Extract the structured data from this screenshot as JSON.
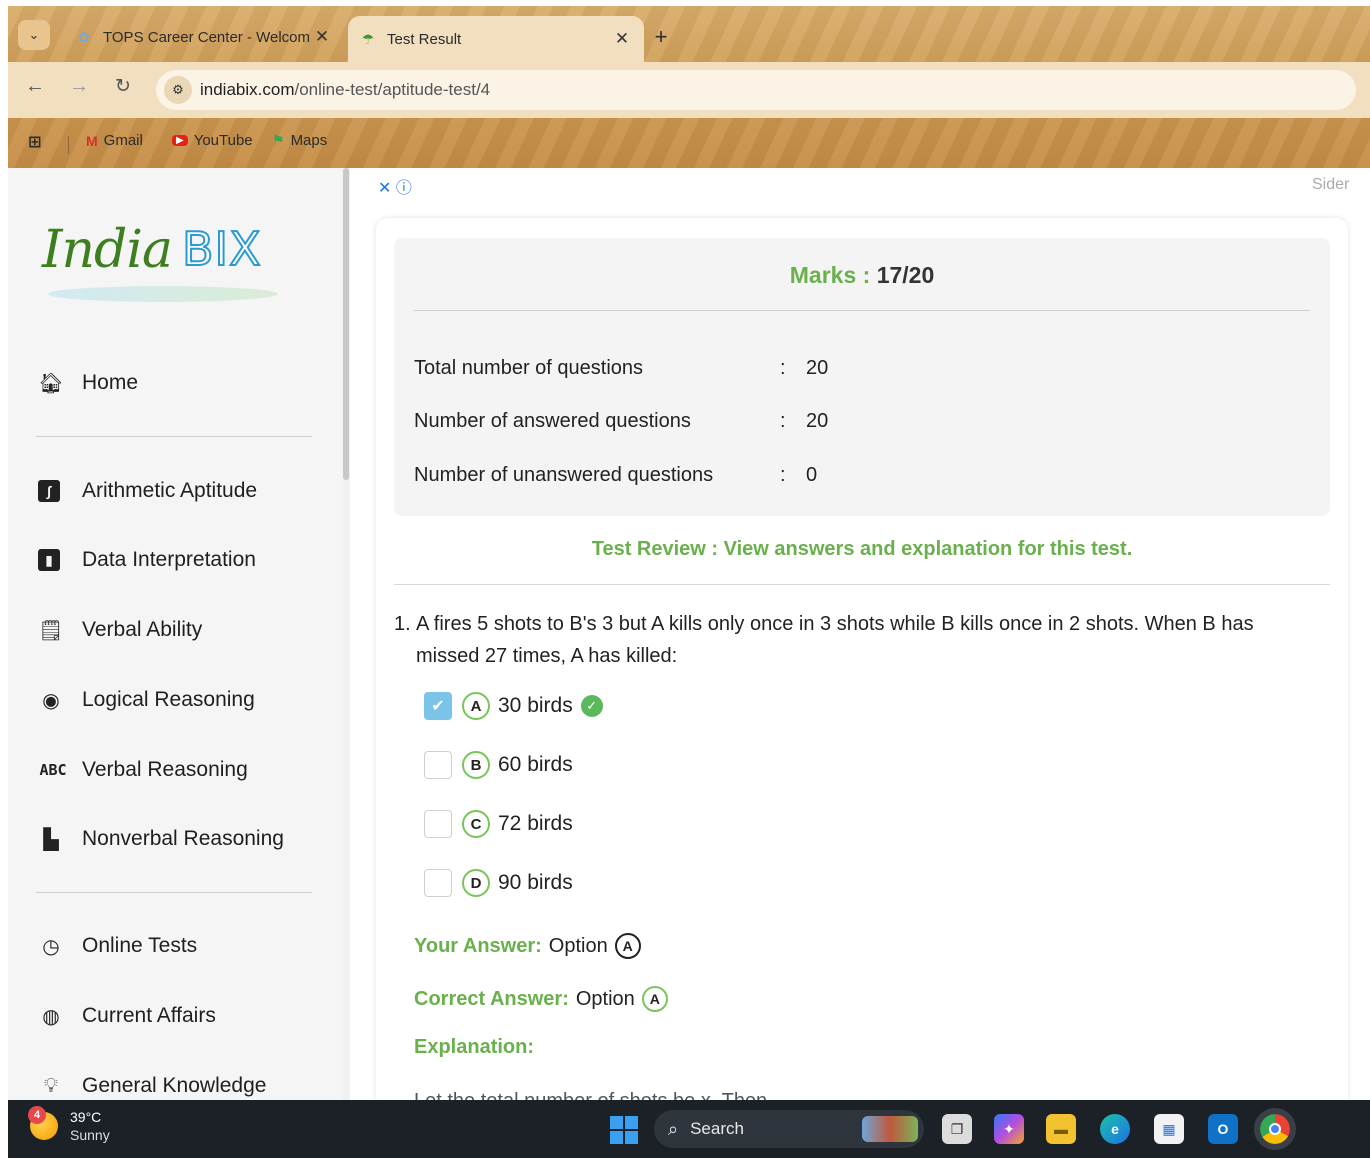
{
  "browser": {
    "tabs": [
      {
        "title": "TOPS Career Center - Welcome",
        "active": false
      },
      {
        "title": "Test Result",
        "active": true
      }
    ],
    "url_domain": "indiabix.com",
    "url_path": "/online-test/aptitude-test/4",
    "bookmarks": [
      "Gmail",
      "YouTube",
      "Maps"
    ]
  },
  "sidebar": {
    "logo": {
      "part1": "India",
      "part2": "BIX"
    },
    "items": [
      {
        "label": "Home",
        "icon": "home-icon"
      },
      {
        "label": "Arithmetic Aptitude",
        "icon": "integral-icon"
      },
      {
        "label": "Data Interpretation",
        "icon": "bar-chart-icon"
      },
      {
        "label": "Verbal Ability",
        "icon": "document-check-icon"
      },
      {
        "label": "Logical Reasoning",
        "icon": "logic-icon"
      },
      {
        "label": "Verbal Reasoning",
        "icon": "abc-icon",
        "icon_text": "ABC"
      },
      {
        "label": "Nonverbal Reasoning",
        "icon": "shapes-icon"
      },
      {
        "label": "Online Tests",
        "icon": "clock-icon"
      },
      {
        "label": "Current Affairs",
        "icon": "globe-icon"
      },
      {
        "label": "General Knowledge",
        "icon": "lightbulb-icon"
      }
    ]
  },
  "ad": {
    "close": "✕",
    "info": "ⓘ",
    "sider": "Sider"
  },
  "result": {
    "marks_label": "Marks :",
    "marks_value": "17/20",
    "rows": [
      {
        "label": "Total number of questions",
        "value": "20"
      },
      {
        "label": "Number of answered questions",
        "value": "20"
      },
      {
        "label": "Number of unanswered questions",
        "value": "0"
      }
    ],
    "review_link": "Test Review : View answers and explanation for this test."
  },
  "question": {
    "number": "1.",
    "text": "A fires 5 shots to B's 3 but A kills only once in 3 shots while B kills once in 2 shots. When B has missed 27 times, A has killed:",
    "options": [
      {
        "letter": "A",
        "text": "30 birds",
        "checked": true,
        "correct": true
      },
      {
        "letter": "B",
        "text": "60 birds",
        "checked": false,
        "correct": false
      },
      {
        "letter": "C",
        "text": "72 birds",
        "checked": false,
        "correct": false
      },
      {
        "letter": "D",
        "text": "90 birds",
        "checked": false,
        "correct": false
      }
    ],
    "your_answer_label": "Your Answer:",
    "your_answer_value": "Option",
    "your_answer_letter": "A",
    "correct_answer_label": "Correct Answer:",
    "correct_answer_value": "Option",
    "correct_answer_letter": "A",
    "explanation_label": "Explanation:",
    "explanation_cutoff": "Let the total number of shots be x. Then,"
  },
  "taskbar": {
    "weather_temp": "39°C",
    "weather_cond": "Sunny",
    "weather_badge": "4",
    "search_placeholder": "Search"
  },
  "colors": {
    "accent_green": "#6ab04c",
    "link_blue": "#1a73e8",
    "checkbox_blue": "#7cc3e8"
  }
}
